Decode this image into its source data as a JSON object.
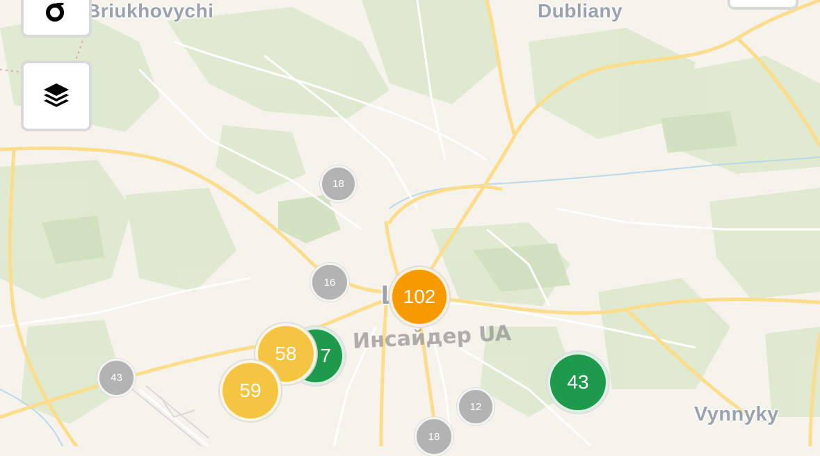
{
  "places": [
    {
      "key": "briukhovychi",
      "label": "Briukhovychi"
    },
    {
      "key": "dubliany",
      "label": "Dubliany"
    },
    {
      "key": "vynnyky",
      "label": "Vynnyky"
    }
  ],
  "city_label_partial": "L   V",
  "watermark": "Инсайдер UA",
  "markers": [
    {
      "value": "18",
      "kind": "gray"
    },
    {
      "value": "16",
      "kind": "gray"
    },
    {
      "value": "43",
      "kind": "gray"
    },
    {
      "value": "12",
      "kind": "gray"
    },
    {
      "value": "18",
      "kind": "gray"
    },
    {
      "value": "102",
      "kind": "orange"
    },
    {
      "value": "7",
      "kind": "green"
    },
    {
      "value": "58",
      "kind": "yellow"
    },
    {
      "value": "59",
      "kind": "yellow"
    },
    {
      "value": "43",
      "kind": "green"
    }
  ],
  "controls": {
    "top_icon": "location-icon",
    "layers_icon": "layers-icon"
  },
  "colors": {
    "gray": "#b3b3b3",
    "orange": "#f79a00",
    "yellow": "#f5c440",
    "green": "#1e9a4c"
  }
}
